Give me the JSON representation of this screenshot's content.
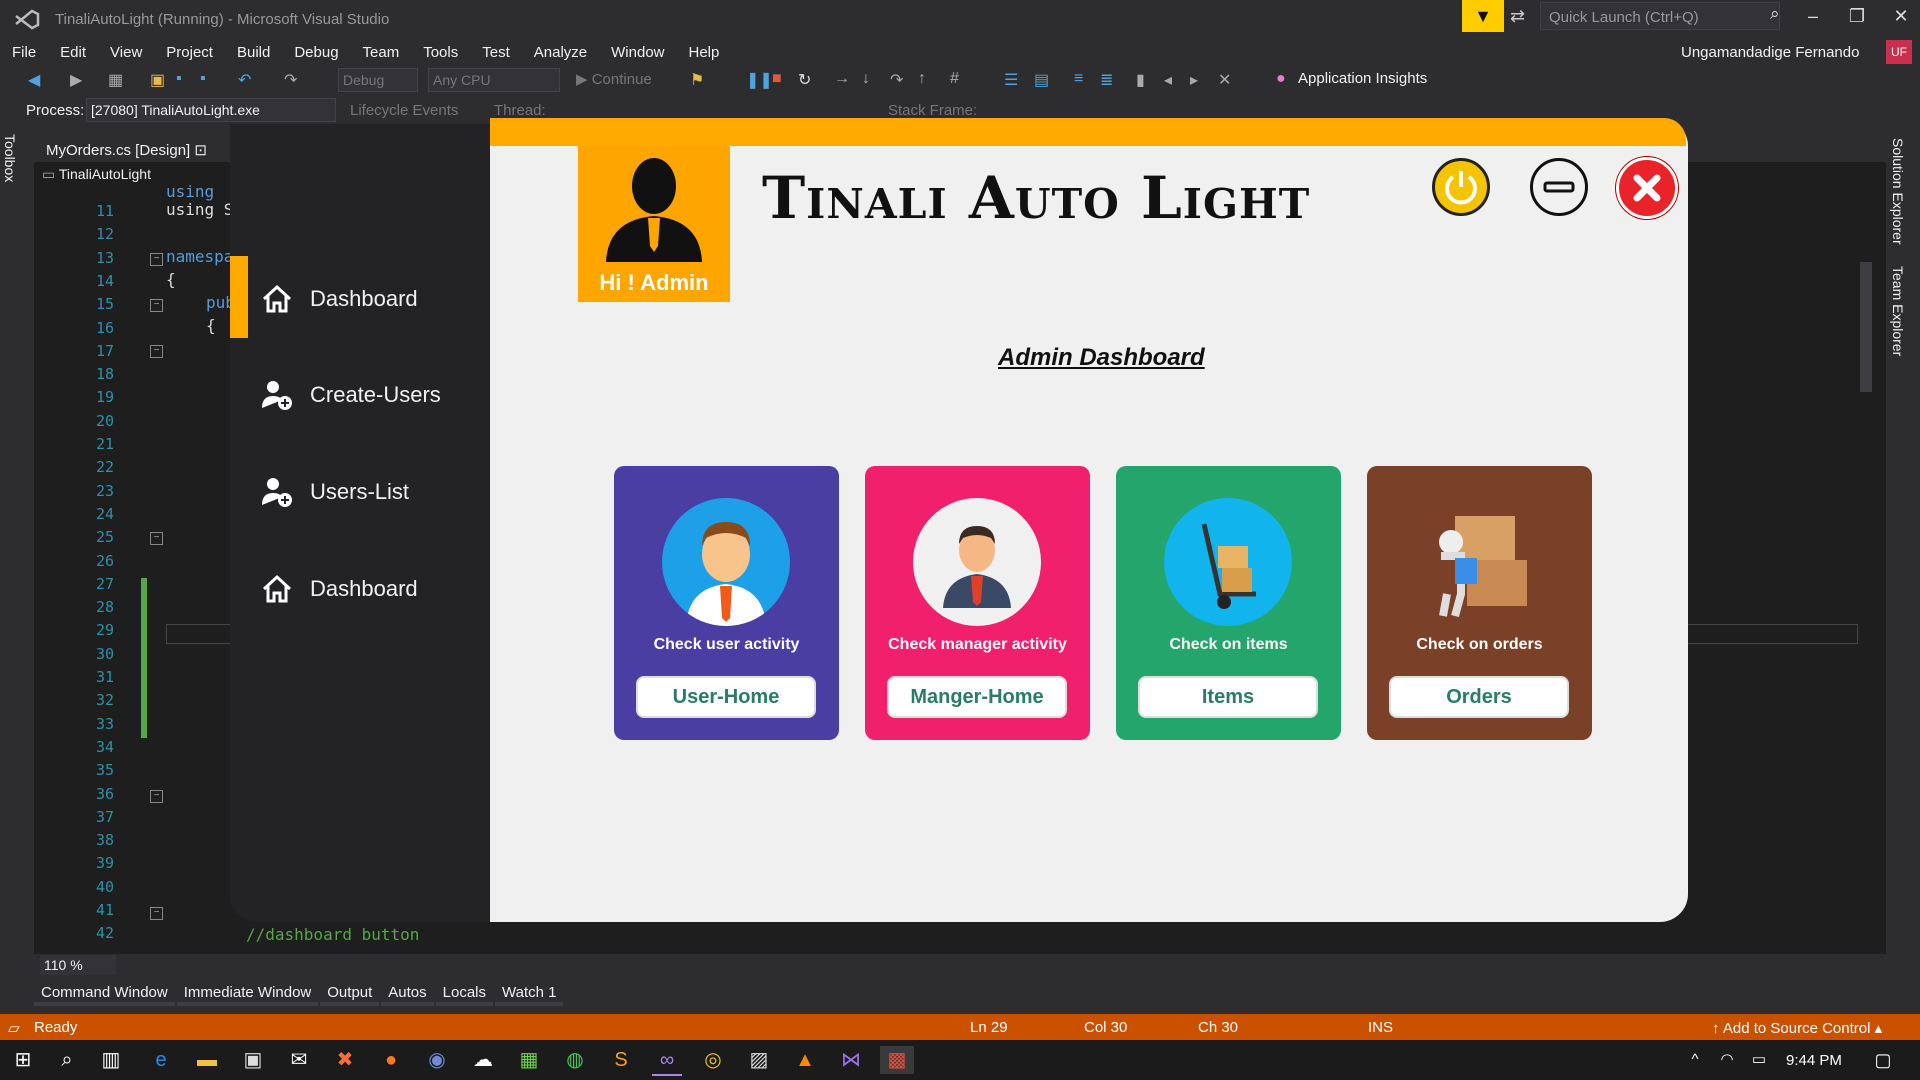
{
  "window": {
    "title": "TinaliAutoLight (Running) - Microsoft Visual Studio",
    "quick_launch_placeholder": "Quick Launch (Ctrl+Q)",
    "user_name": "Ungamandadige Fernando",
    "user_initials": "UF"
  },
  "menu": [
    "File",
    "Edit",
    "View",
    "Project",
    "Build",
    "Debug",
    "Team",
    "Tools",
    "Test",
    "Analyze",
    "Window",
    "Help"
  ],
  "toolbar": {
    "config": "Debug",
    "platform": "Any CPU",
    "continue_label": "Continue",
    "app_insights": "Application Insights"
  },
  "debugbar": {
    "process_label": "Process:",
    "process_value": "[27080] TinaliAutoLight.exe",
    "lifecycle": "Lifecycle Events",
    "thread": "Thread:",
    "stack_frame": "Stack Frame:"
  },
  "side": {
    "toolbox": "Toolbox",
    "solution_explorer": "Solution Explorer",
    "team_explorer": "Team Explorer"
  },
  "editor": {
    "tab": "MyOrders.cs [Design]",
    "nav": "TinaliAutoLight",
    "line_numbers": [
      "11",
      "12",
      "13",
      "14",
      "15",
      "16",
      "17",
      "18",
      "19",
      "20",
      "21",
      "22",
      "23",
      "24",
      "25",
      "26",
      "27",
      "28",
      "29",
      "30",
      "31",
      "32",
      "33",
      "34",
      "35",
      "36",
      "37",
      "38",
      "39",
      "40",
      "41",
      "42"
    ],
    "code_using1": "using",
    "code_using2": "using S",
    "code_namespace": "namespa",
    "code_brace": "{",
    "code_pub": "pub",
    "code_brace2": "{",
    "comment": "//dashboard button",
    "zoom": "110 %"
  },
  "tool_tabs": [
    "Command Window",
    "Immediate Window",
    "Output",
    "Autos",
    "Locals",
    "Watch 1"
  ],
  "status": {
    "state": "Ready",
    "ln": "Ln 29",
    "col": "Col 30",
    "ch": "Ch 30",
    "ins": "INS",
    "source_control": "Add to Source Control"
  },
  "clock": "9:44 PM",
  "app": {
    "greeting": "Hi ! Admin",
    "title": "Tinali Auto Light",
    "heading": "Admin Dashboard",
    "nav": [
      "Dashboard",
      "Create-Users",
      "Users-List",
      "Dashboard"
    ],
    "cards": [
      {
        "caption": "Check user activity",
        "button": "User-Home",
        "color": "#4a3ea3",
        "btn_color": "#2a7d63"
      },
      {
        "caption": "Check manager activity",
        "button": "Manger-Home",
        "color": "#f0206d",
        "btn_color": "#2a7d63"
      },
      {
        "caption": "Check on items",
        "button": "Items",
        "color": "#24a56c",
        "btn_color": "#2a7d63"
      },
      {
        "caption": "Check on orders",
        "button": "Orders",
        "color": "#7b4128",
        "btn_color": "#2a7d63"
      }
    ]
  }
}
